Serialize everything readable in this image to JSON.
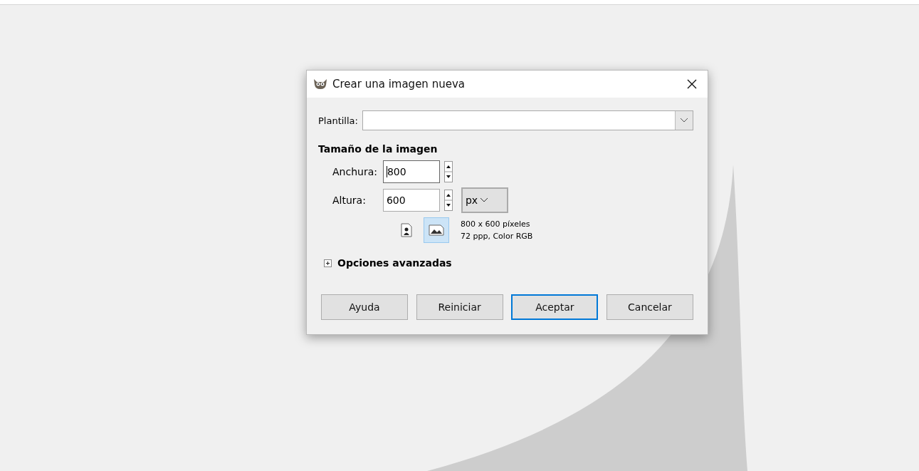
{
  "dialog": {
    "title": "Crear una imagen nueva",
    "template": {
      "label": "Plantilla:"
    },
    "section_title": "Tamaño de la imagen",
    "fields": [
      {
        "label": "Anchura:",
        "value": "800",
        "focused": true
      },
      {
        "label": "Altura:",
        "value": "600",
        "focused": false
      }
    ],
    "unit": "px",
    "orientations": [
      {
        "kind": "portrait",
        "selected": false
      },
      {
        "kind": "landscape",
        "selected": true
      }
    ],
    "info_lines": [
      "800 x 600 píxeles",
      "72 ppp, Color RGB"
    ],
    "advanced": {
      "label": "Opciones avanzadas",
      "expanded": false
    },
    "buttons": [
      {
        "label": "Ayuda",
        "default": false
      },
      {
        "label": "Reiniciar",
        "default": false
      },
      {
        "label": "Aceptar",
        "default": true
      },
      {
        "label": "Cancelar",
        "default": false
      }
    ]
  }
}
